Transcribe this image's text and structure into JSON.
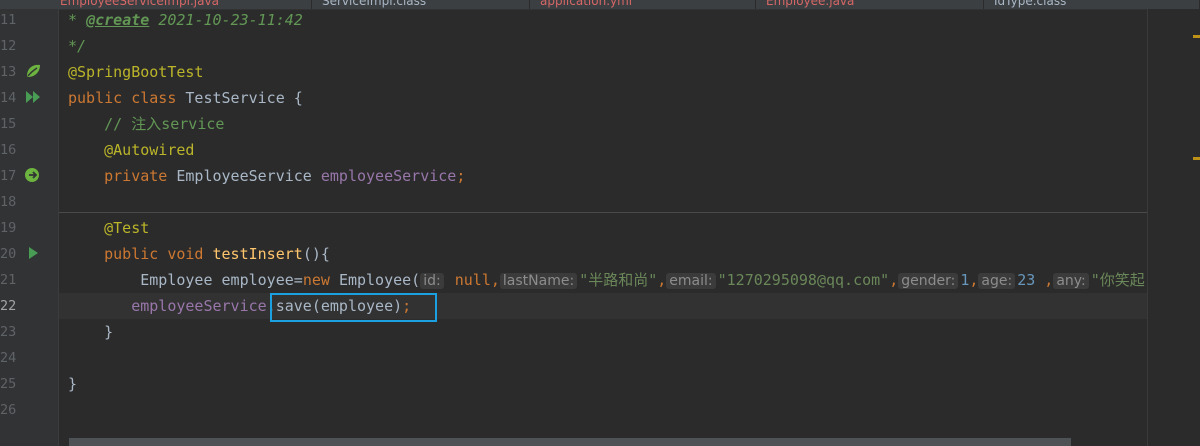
{
  "tabs": [
    {
      "label": "EmployeeServiceImpl.java",
      "color": "#d56767"
    },
    {
      "label": "ServiceImpl.class",
      "color": "#a9b7c6"
    },
    {
      "label": "application.yml",
      "color": "#d56767"
    },
    {
      "label": "Employee.java",
      "color": "#d56767"
    },
    {
      "label": "IdType.class",
      "color": "#a9b7c6"
    }
  ],
  "line_numbers": [
    "11",
    "12",
    "13",
    "14",
    "15",
    "16",
    "17",
    "18",
    "19",
    "20",
    "21",
    "22",
    "23",
    "24",
    "25",
    "26"
  ],
  "current_line": "22",
  "code": {
    "l11_star": " * ",
    "l11_tag": "@create",
    "l11_date": " 2021-10-23-11:42",
    "l12": " */",
    "l13": "@SpringBootTest",
    "l14_kw": "public class ",
    "l14_rest": "TestService {",
    "l15": "    // 注入service",
    "l16": "    @Autowired",
    "l17_kw": "    private ",
    "l17_type": "EmployeeService ",
    "l17_field": "employeeService",
    "l17_semi": ";",
    "l19": "    @Test",
    "l20_kw": "    public void ",
    "l20_fn": "testInsert",
    "l20_rest": "(){",
    "l21_a": "        Employee employee=",
    "l21_new": "new ",
    "l21_b": "Employee(",
    "hint_id": "id:",
    "l21_null": " null",
    "comma": ",",
    "hint_lastName": "lastName:",
    "l21_name": "\"半路和尚\"",
    "hint_email": "email:",
    "l21_email": "\"1270295098@qq.com\"",
    "hint_gender": "gender:",
    "l21_gender": "1",
    "hint_age": "age:",
    "l21_age": "23 ",
    "hint_any": "any:",
    "l21_any": "\"你笑起",
    "l22_field": "       employeeService",
    "l22_dot": ".",
    "l22_call": "save(employee)",
    "l22_semi": ";",
    "l23": "    }",
    "l25": "}"
  },
  "gutter_icons": {
    "l13": "spring-bean-icon",
    "l14": "run-all-icon",
    "l17": "autowired-bean-icon",
    "l20": "run-test-icon"
  },
  "colors": {
    "keyword": "#cc7832",
    "annotation": "#bbb529",
    "string": "#6a8759",
    "number": "#6897bb",
    "field": "#9876aa",
    "highlight_box": "#1ba1e2"
  }
}
